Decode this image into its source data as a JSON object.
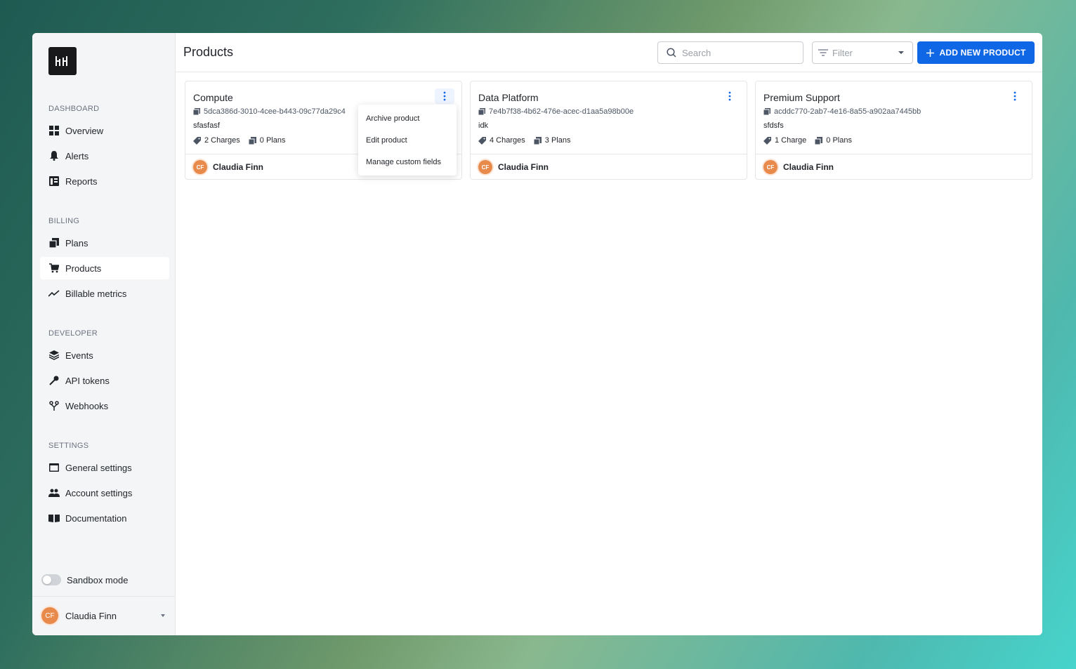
{
  "sidebar": {
    "sections": [
      {
        "title": "DASHBOARD",
        "items": [
          {
            "label": "Overview",
            "icon": "grid-icon"
          },
          {
            "label": "Alerts",
            "icon": "bell-icon"
          },
          {
            "label": "Reports",
            "icon": "report-icon"
          }
        ]
      },
      {
        "title": "BILLING",
        "items": [
          {
            "label": "Plans",
            "icon": "plans-icon"
          },
          {
            "label": "Products",
            "icon": "cart-icon",
            "active": true
          },
          {
            "label": "Billable metrics",
            "icon": "chart-line-icon"
          }
        ]
      },
      {
        "title": "DEVELOPER",
        "items": [
          {
            "label": "Events",
            "icon": "layers-icon"
          },
          {
            "label": "API tokens",
            "icon": "key-icon"
          },
          {
            "label": "Webhooks",
            "icon": "webhook-icon"
          }
        ]
      },
      {
        "title": "SETTINGS",
        "items": [
          {
            "label": "General settings",
            "icon": "window-icon"
          },
          {
            "label": "Account settings",
            "icon": "users-icon"
          },
          {
            "label": "Documentation",
            "icon": "book-icon"
          }
        ]
      }
    ],
    "sandbox_label": "Sandbox mode",
    "user": {
      "initials": "CF",
      "name": "Claudia Finn"
    }
  },
  "header": {
    "title": "Products",
    "search_placeholder": "Search",
    "filter_placeholder": "Filter",
    "add_button": "ADD NEW PRODUCT"
  },
  "products": [
    {
      "name": "Compute",
      "id": "5dca386d-3010-4cee-b443-09c77da29c4",
      "description": "sfasfasf",
      "charges": "2 Charges",
      "plans": "0 Plans",
      "owner_initials": "CF",
      "owner": "Claudia Finn"
    },
    {
      "name": "Data Platform",
      "id": "7e4b7f38-4b62-476e-acec-d1aa5a98b00e",
      "description": "idk",
      "charges": "4 Charges",
      "plans": "3 Plans",
      "owner_initials": "CF",
      "owner": "Claudia Finn"
    },
    {
      "name": "Premium Support",
      "id": "acddc770-2ab7-4e16-8a55-a902aa7445bb",
      "description": "sfdsfs",
      "charges": "1 Charge",
      "plans": "0 Plans",
      "owner_initials": "CF",
      "owner": "Claudia Finn"
    }
  ],
  "menu": {
    "items": [
      "Archive product",
      "Edit product",
      "Manage custom fields"
    ]
  },
  "colors": {
    "accent": "#1067e6",
    "avatar": "#e88a4c"
  }
}
